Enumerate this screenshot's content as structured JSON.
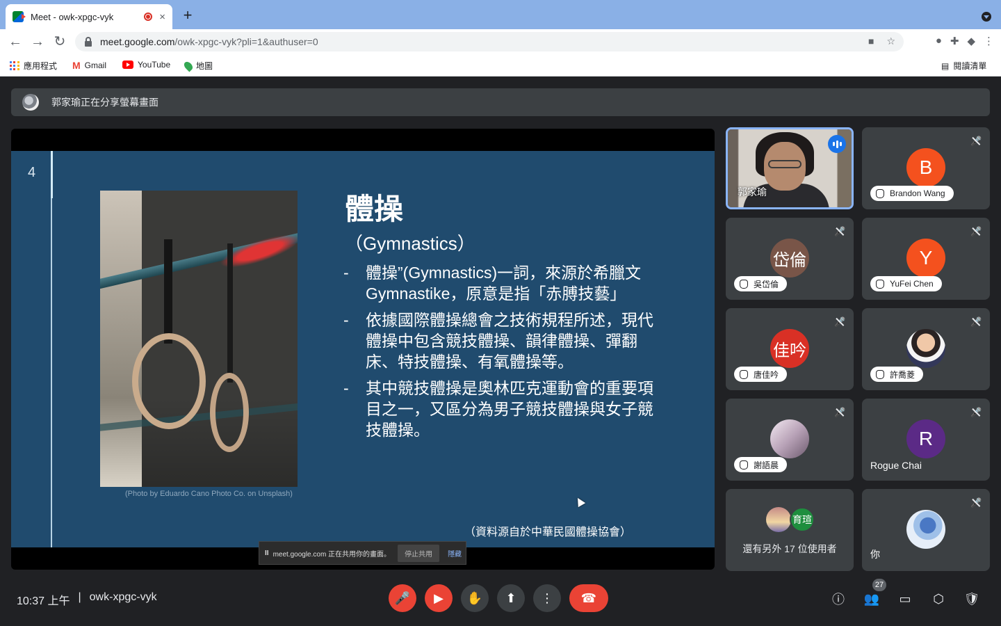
{
  "browser": {
    "tab_title": "Meet - owk-xpgc-vyk",
    "tab_close": "×",
    "new_tab": "+",
    "url_host": "meet.google.com",
    "url_path": "/owk-xpgc-vyk?pli=1&authuser=0",
    "bookmarks": {
      "apps": "應用程式",
      "gmail": "Gmail",
      "youtube": "YouTube",
      "maps": "地圖",
      "reading_list": "閱讀清單"
    }
  },
  "meet": {
    "presenting_banner": "郭家瑜正在分享螢幕畫面",
    "slide": {
      "number": "4",
      "title": "體操",
      "subtitle": "（Gymnastics）",
      "bullets": [
        "體操”(Gymnastics)一詞，來源於希臘文 Gymnastike，原意是指「赤膊技藝」",
        "依據國際體操總會之技術規程所述，現代體操中包含競技體操、韻律體操、彈翻床、特技體操、有氧體操等。",
        "其中競技體操是奧林匹克運動會的重要項目之一，又區分為男子競技體操與女子競技體操。"
      ],
      "bullet_dash": "-",
      "photo_credit": "(Photo by Eduardo Cano Photo Co. on Unsplash)",
      "source": "（資料源自於中華民國體操協會）"
    },
    "share_bar": {
      "pause": "II",
      "message": "meet.google.com 正在共用你的畫面。",
      "stop": "停止共用",
      "hide": "隱藏"
    },
    "participants": [
      {
        "name": "郭家瑜",
        "type": "video"
      },
      {
        "name": "Brandon Wang",
        "initial": "B",
        "color": "#f4511e",
        "hand": true
      },
      {
        "name": "吳岱倫",
        "initial": "岱倫",
        "color": "#795548",
        "hand": true
      },
      {
        "name": "YuFei Chen",
        "initial": "Y",
        "color": "#f4511e",
        "hand": true
      },
      {
        "name": "唐佳吟",
        "initial": "佳吟",
        "color": "#d93025",
        "hand": true
      },
      {
        "name": "許喬菱",
        "type": "photo",
        "hand": true
      },
      {
        "name": "謝語晨",
        "type": "photo",
        "hand": true
      },
      {
        "name": "Rogue Chai",
        "initial": "R",
        "color": "#5b2a86",
        "hand": false
      }
    ],
    "others": {
      "avatar_text": "育瑄",
      "label": "還有另外 17 位使用者"
    },
    "self_name": "你",
    "time": "10:37 上午",
    "separator": "|",
    "meeting_code": "owk-xpgc-vyk",
    "people_count": "27"
  }
}
